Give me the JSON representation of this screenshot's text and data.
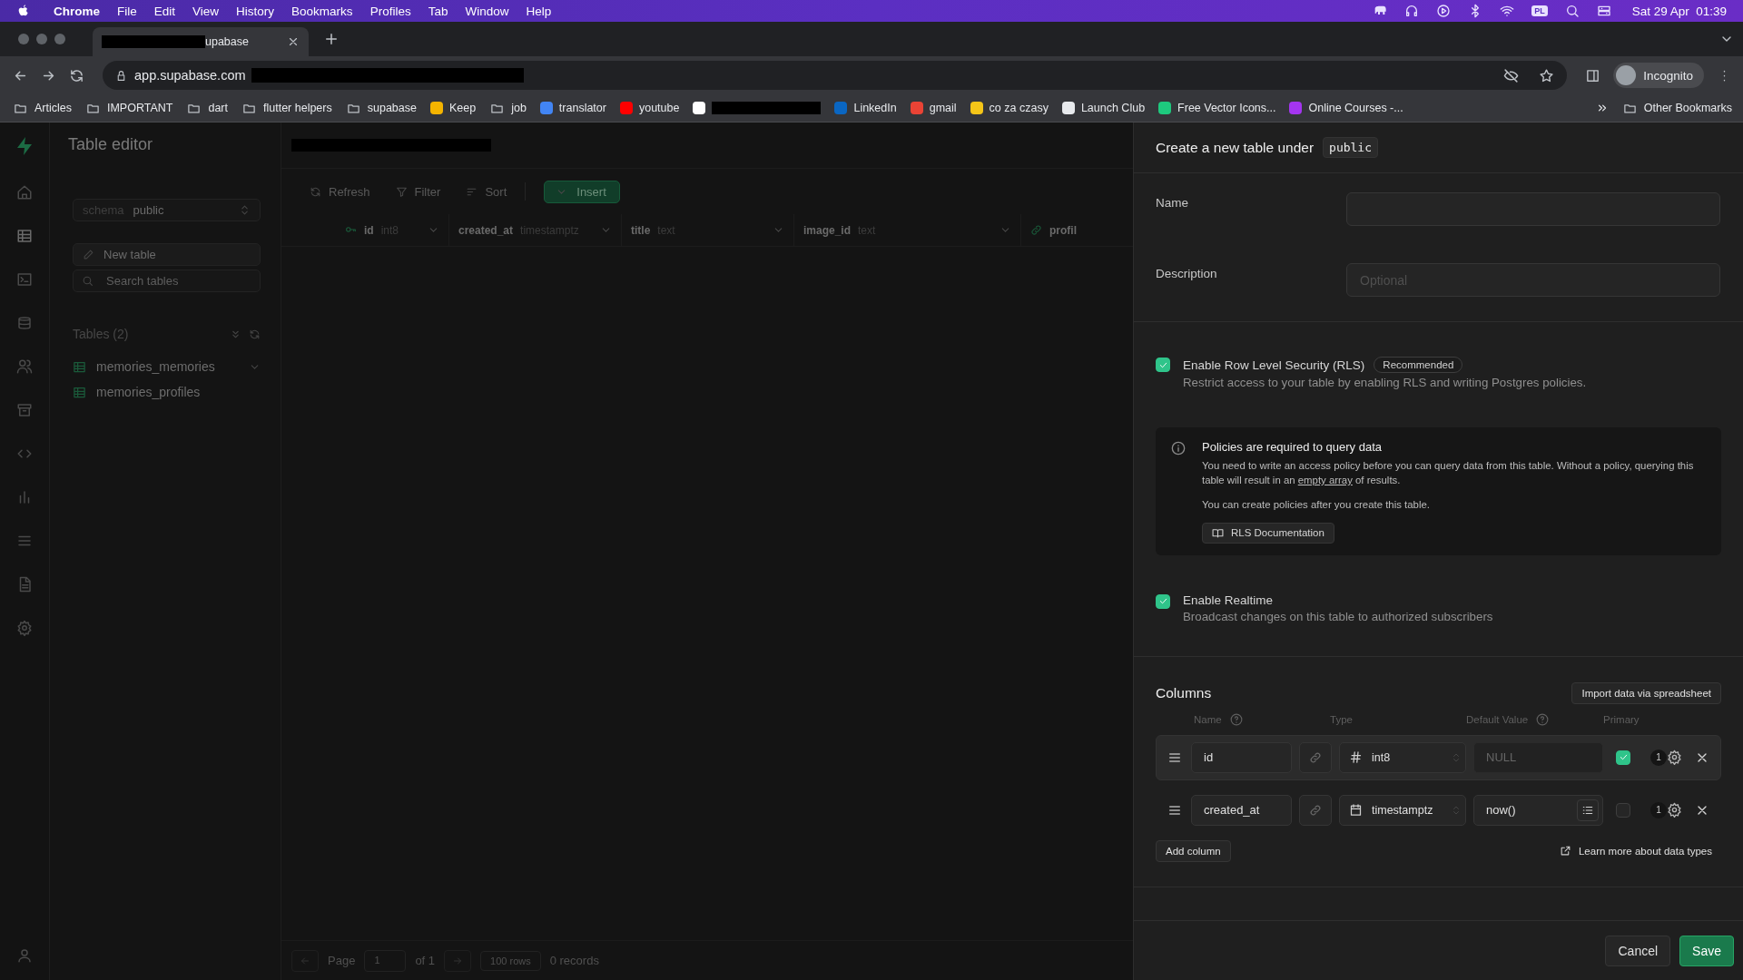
{
  "menu_bar": {
    "app": "Chrome",
    "items": [
      "File",
      "Edit",
      "View",
      "History",
      "Bookmarks",
      "Profiles",
      "Tab",
      "Window",
      "Help"
    ],
    "input_source": "PL",
    "clock": "Sat 29 Apr  01:39"
  },
  "browser": {
    "tab": {
      "title": "upabase",
      "redacted": true
    },
    "address": {
      "url": "app.supabase.com",
      "redacted": true
    },
    "profile": "Incognito",
    "bookmarks": [
      {
        "kind": "folder",
        "label": "Articles"
      },
      {
        "kind": "folder",
        "label": "IMPORTANT"
      },
      {
        "kind": "folder",
        "label": "dart"
      },
      {
        "kind": "folder",
        "label": "flutter helpers"
      },
      {
        "kind": "folder",
        "label": "supabase"
      },
      {
        "kind": "site",
        "label": "Keep",
        "color": "#f4b400"
      },
      {
        "kind": "folder",
        "label": "job"
      },
      {
        "kind": "site",
        "label": "translator",
        "color": "#4285f4"
      },
      {
        "kind": "site",
        "label": "youtube",
        "color": "#ff0000"
      },
      {
        "kind": "site",
        "redacted": true,
        "color": "#ffffff"
      },
      {
        "kind": "site",
        "label": "LinkedIn",
        "color": "#0a66c2"
      },
      {
        "kind": "site",
        "label": "gmail",
        "color": "#ea4335"
      },
      {
        "kind": "site",
        "label": "co za czasy",
        "color": "#f5c518"
      },
      {
        "kind": "site",
        "label": "Launch Club",
        "color": "#e8eaed"
      },
      {
        "kind": "site",
        "label": "Free Vector Icons...",
        "color": "#1ec97e"
      },
      {
        "kind": "site",
        "label": "Online Courses -...",
        "color": "#a435f0"
      }
    ],
    "other_bookmarks": "Other Bookmarks"
  },
  "sidebar": {
    "title": "Table editor",
    "schema": {
      "label": "schema",
      "value": "public"
    },
    "new_table": "New table",
    "search": {
      "placeholder": "Search tables"
    },
    "tables_heading": "Tables (2)",
    "tables": [
      {
        "name": "memories_memories",
        "expanded": true
      },
      {
        "name": "memories_profiles",
        "expanded": false
      }
    ]
  },
  "main": {
    "header_redacted": true,
    "toolbar": [
      "Refresh",
      "Filter",
      "Sort"
    ],
    "insert": "Insert",
    "grid_columns": [
      {
        "name": "id",
        "type": "int8",
        "kind": "primary"
      },
      {
        "name": "created_at",
        "type": "timestamptz",
        "kind": "plain"
      },
      {
        "name": "title",
        "type": "text",
        "kind": "plain"
      },
      {
        "name": "image_id",
        "type": "text",
        "kind": "plain"
      },
      {
        "name": "profil",
        "kind": "foreign"
      }
    ],
    "footer": {
      "page_label": "Page",
      "page": "1",
      "of": "of 1",
      "rows": "100 rows",
      "records": "0 records"
    }
  },
  "panel": {
    "title": "Create a new table under",
    "schema": "public",
    "name_field": {
      "label": "Name"
    },
    "description_field": {
      "label": "Description",
      "placeholder": "Optional"
    },
    "rls": {
      "checked": true,
      "label": "Enable Row Level Security (RLS)",
      "badge": "Recommended",
      "description": "Restrict access to your table by enabling RLS and writing Postgres policies."
    },
    "callout": {
      "title": "Policies are required to query data",
      "text_before": "You need to write an access policy before you can query data from this table. Without a policy, querying this table will result in an",
      "link": "empty array",
      "text_after": "of results.",
      "note": "You can create policies after you create this table.",
      "button": "RLS Documentation"
    },
    "realtime": {
      "checked": true,
      "label": "Enable Realtime",
      "description": "Broadcast changes on this table to authorized subscribers"
    },
    "columns_title": "Columns",
    "import_button": "Import data via spreadsheet",
    "column_headers": [
      {
        "label": "Name",
        "help": true
      },
      {
        "label": "Type",
        "help": false
      },
      {
        "label": "Default Value",
        "help": true
      },
      {
        "label": "Primary",
        "help": false
      }
    ],
    "columns": [
      {
        "name": "id",
        "type": "int8",
        "kind": "number",
        "default_placeholder": "NULL",
        "primary": true,
        "selected": true,
        "count": "1"
      },
      {
        "name": "created_at",
        "type": "timestamptz",
        "kind": "date",
        "default": "now()",
        "primary": false,
        "selected": false,
        "count": "1"
      }
    ],
    "add_column": "Add column",
    "learn_more": "Learn more about data types",
    "cancel": "Cancel",
    "save": "Save"
  }
}
